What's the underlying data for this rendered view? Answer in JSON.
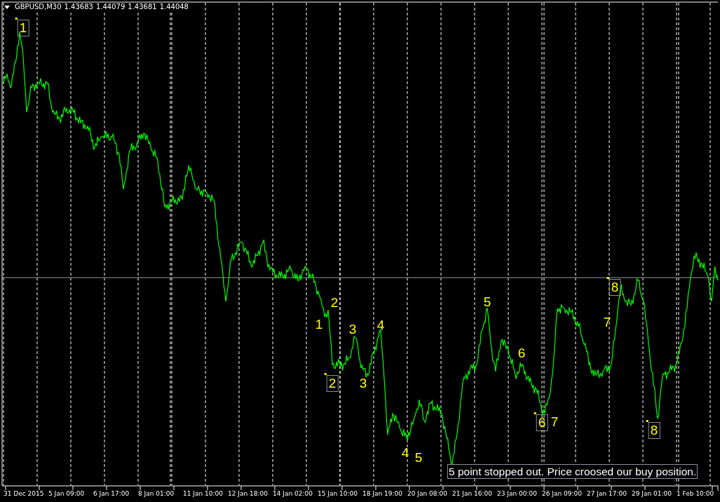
{
  "header": {
    "symbol": "GBPUSD,M30",
    "prices": [
      "1.43683",
      "1.44079",
      "1.43681",
      "1.44048"
    ]
  },
  "wave_labels": [
    {
      "text": "1",
      "boxed": true
    },
    {
      "text": "1",
      "boxed": false
    },
    {
      "text": "2",
      "boxed": false
    },
    {
      "text": "3",
      "boxed": false
    },
    {
      "text": "4",
      "boxed": false
    },
    {
      "text": "2",
      "boxed": true
    },
    {
      "text": "3",
      "boxed": false
    },
    {
      "text": "4",
      "boxed": false
    },
    {
      "text": "5",
      "boxed": false
    },
    {
      "text": "5",
      "boxed": false
    },
    {
      "text": "6",
      "boxed": false
    },
    {
      "text": "6",
      "boxed": true
    },
    {
      "text": "7",
      "boxed": false
    },
    {
      "text": "7",
      "boxed": false
    },
    {
      "text": "8",
      "boxed": true
    },
    {
      "text": "8",
      "boxed": true
    }
  ],
  "note": {
    "text": "5 point stopped out. Price croosed our buy position."
  },
  "time_axis": {
    "labels": [
      "31 Dec 2015",
      "5 Jan 09:00",
      "6 Jan 17:00",
      "8 Jan 01:00",
      "11 Jan 10:00",
      "12 Jan 18:00",
      "14 Jan 02:00",
      "15 Jan 10:00",
      "18 Jan 19:00",
      "20 Jan 08:00",
      "21 Jan 16:00",
      "23 Jan 00:00",
      "26 Jan 09:00",
      "27 Jan 17:00",
      "29 Jan 01:00",
      "1 Feb 10:00"
    ]
  }
}
